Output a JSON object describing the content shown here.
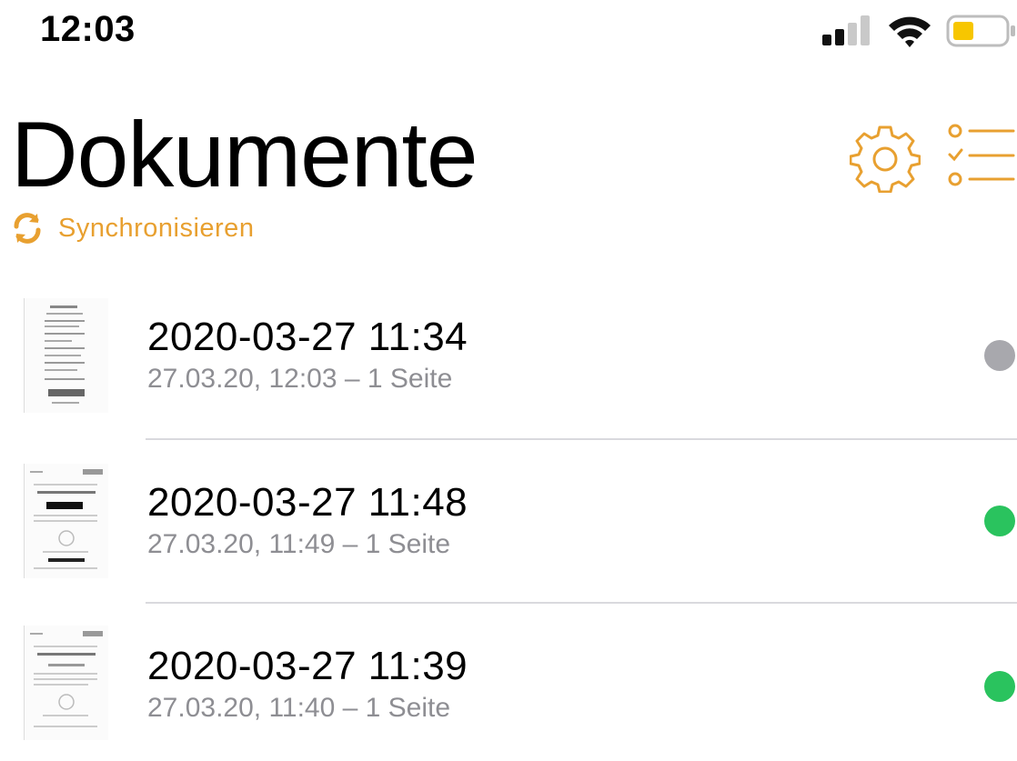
{
  "status_bar": {
    "time": "12:03",
    "icons": [
      "cellular-signal-icon",
      "wifi-icon",
      "battery-low-icon"
    ],
    "battery_color": "#f7c600"
  },
  "header": {
    "title": "Dokumente",
    "sync_label": "Synchronisieren",
    "accent_color": "#e8a030",
    "actions": [
      "gear-icon",
      "checklist-icon"
    ]
  },
  "documents": [
    {
      "title": "2020-03-27 11:34",
      "subtitle": "27.03.20, 12:03 – 1 Seite",
      "status_color": "#a8a8ad",
      "thumbnail": "receipt-thumbnail"
    },
    {
      "title": "2020-03-27 11:48",
      "subtitle": "27.03.20, 11:49 – 1 Seite",
      "status_color": "#2ac35e",
      "thumbnail": "schufa-letter-thumbnail"
    },
    {
      "title": "2020-03-27 11:39",
      "subtitle": "27.03.20, 11:40 – 1 Seite",
      "status_color": "#2ac35e",
      "thumbnail": "schufa-letter-thumbnail"
    }
  ]
}
